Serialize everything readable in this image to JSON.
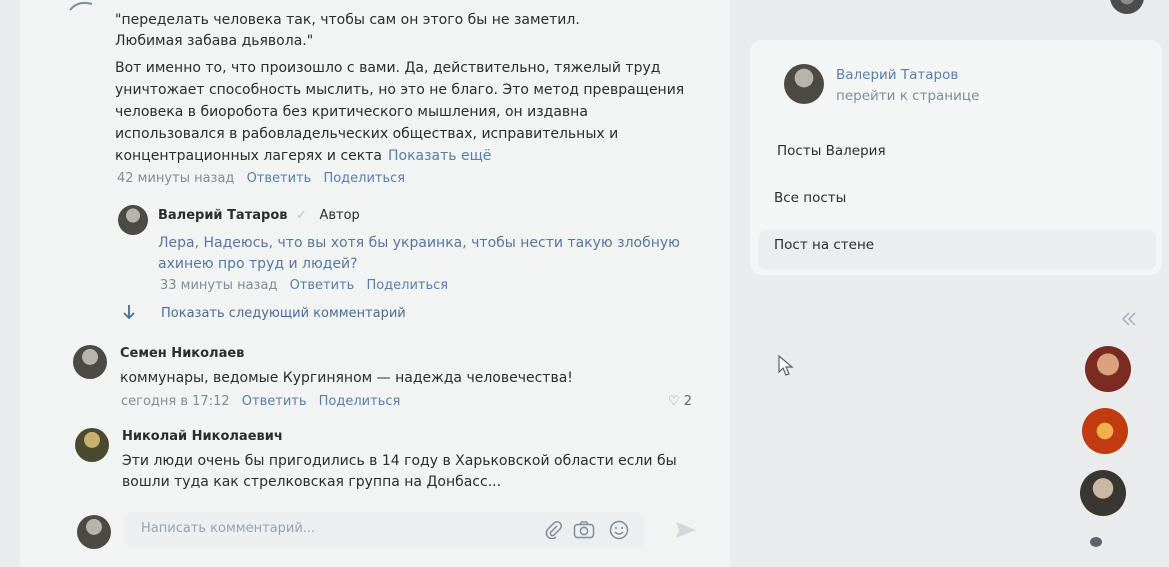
{
  "comment1": {
    "lines": [
      "\"переделать человека так, чтобы сам он этого бы не заметил.",
      "Любимая забава дьявола.\"",
      "Вот именно то, что произошло с вами. Да, действительно, тяжелый труд",
      "уничтожает способность мыслить, но это не благо. Это метод превращения",
      "человека в биоробота без критического мышления, он издавна",
      "использовался в рабовладельческих обществах, исправительных и",
      "концентрационных лагерях и секта"
    ],
    "show_more": "Показать ещё",
    "time": "42 минуты назад",
    "reply": "Ответить",
    "share": "Поделиться"
  },
  "reply1": {
    "author": "Валерий Татаров",
    "author_badge": "Автор",
    "lines": [
      "Лера, Надеюсь, что вы хотя бы украинка, чтобы нести такую злобную",
      "ахинею про труд и людей?"
    ],
    "time": "33 минуты назад",
    "reply": "Ответить",
    "share": "Поделиться"
  },
  "show_next": "Показать следующий комментарий",
  "comment2": {
    "author": "Семен Николаев",
    "text": "коммунары, ведомые Кургиняном — надежда человечества!",
    "time": "сегодня в 17:12",
    "reply": "Ответить",
    "share": "Поделиться",
    "likes": "2"
  },
  "comment3": {
    "author": "Николай Николаевич",
    "lines": [
      "Эти люди очень бы пригодились в 14 году в Харьковской области если бы",
      "вошли туда как стрелковская группа на Донбасс..."
    ]
  },
  "composer": {
    "placeholder": "Написать комментарий..."
  },
  "sidebar": {
    "profile_name": "Валерий Татаров",
    "profile_link": "перейти к странице",
    "items": [
      "Посты Валерия",
      "Все посты",
      "Пост на стене"
    ]
  },
  "icons": {
    "share_arrow": "share-arrow-icon",
    "down_arrow": "arrow-down-icon",
    "heart": "heart-icon",
    "attach": "paperclip-icon",
    "camera": "camera-icon",
    "emoji": "smile-icon",
    "send": "send-icon",
    "collapse": "double-chevron-left-icon",
    "cursor": "mouse-pointer-icon"
  },
  "colors": {
    "link": "#5b7ea6",
    "meta": "#818c99",
    "reply_text": "#5877a0"
  }
}
